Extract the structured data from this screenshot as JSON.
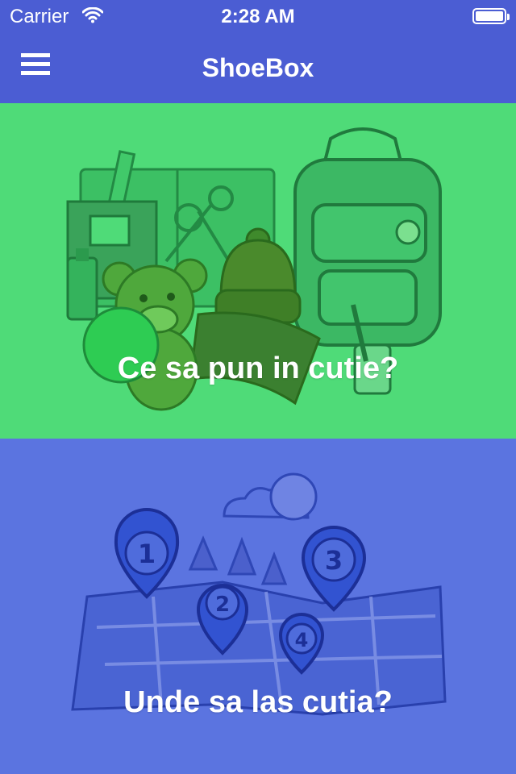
{
  "status_bar": {
    "carrier": "Carrier",
    "time": "2:28 AM"
  },
  "header": {
    "title": "ShoeBox",
    "menu_icon": "hamburger-icon"
  },
  "panels": [
    {
      "label": "Ce sa pun in cutie?",
      "color": "#4fdb78",
      "illustration": "school-supplies-backpack-teddy-hat"
    },
    {
      "label": "Unde sa las cutia?",
      "color": "#5b74e0",
      "illustration": "map-with-location-pins"
    }
  ],
  "colors": {
    "header": "#4b5dd3",
    "green_panel": "#4fdb78",
    "blue_panel": "#5b74e0"
  }
}
